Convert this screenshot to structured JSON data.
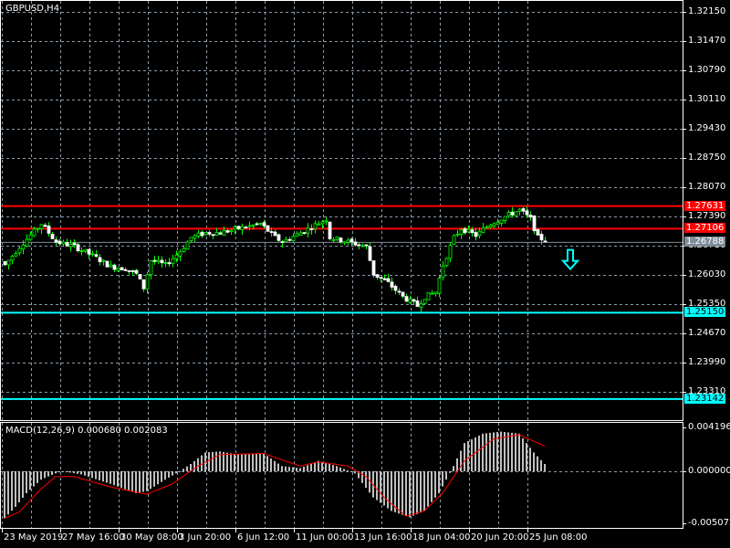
{
  "symbol_title": "GBPUSD,H4",
  "colors": {
    "background": "#000000",
    "grid": "#8a9aaa",
    "bull": "#ffffff",
    "bear": "#ffffff",
    "wick": "#00ff00",
    "resistance": "#ff0000",
    "support": "#00ffff",
    "current": "#7f8c99",
    "macd_hist": "#c0c0c0",
    "macd_signal": "#ff0000",
    "arrow": "#00ffff"
  },
  "chart_data": [
    {
      "type": "candlestick",
      "title": "GBPUSD,H4",
      "y_ticks": [
        "1.32150",
        "1.31470",
        "1.30790",
        "1.30110",
        "1.29430",
        "1.28750",
        "1.28070",
        "1.27390",
        "1.26710",
        "1.26030",
        "1.25350",
        "1.24670",
        "1.23990",
        "1.23310"
      ],
      "ylim": [
        1.2265,
        1.3245
      ],
      "x_labels": [
        "23 May 2019",
        "27 May 16:00",
        "30 May 08:00",
        "3 Jun 20:00",
        "6 Jun 12:00",
        "11 Jun 00:00",
        "13 Jun 16:00",
        "18 Jun 04:00",
        "20 Jun 20:00",
        "25 Jun 08:00"
      ],
      "bar_count": 149,
      "close_keypoints": [
        [
          0,
          1.2626
        ],
        [
          4,
          1.2669
        ],
        [
          10,
          1.2722
        ],
        [
          14,
          1.268
        ],
        [
          19,
          1.2669
        ],
        [
          24,
          1.2648
        ],
        [
          29,
          1.2622
        ],
        [
          33,
          1.2618
        ],
        [
          36,
          1.2605
        ],
        [
          38,
          1.2573
        ],
        [
          40,
          1.2637
        ],
        [
          44,
          1.2626
        ],
        [
          48,
          1.2658
        ],
        [
          51,
          1.269
        ],
        [
          55,
          1.2701
        ],
        [
          59,
          1.2701
        ],
        [
          64,
          1.2711
        ],
        [
          70,
          1.2722
        ],
        [
          74,
          1.269
        ],
        [
          76,
          1.268
        ],
        [
          81,
          1.2701
        ],
        [
          88,
          1.2733
        ],
        [
          89,
          1.269
        ],
        [
          94,
          1.268
        ],
        [
          99,
          1.2669
        ],
        [
          101,
          1.2605
        ],
        [
          105,
          1.2584
        ],
        [
          109,
          1.2552
        ],
        [
          113,
          1.2531
        ],
        [
          115,
          1.2552
        ],
        [
          118,
          1.2563
        ],
        [
          120,
          1.2626
        ],
        [
          123,
          1.269
        ],
        [
          125,
          1.2711
        ],
        [
          129,
          1.2695
        ],
        [
          133,
          1.2722
        ],
        [
          138,
          1.2743
        ],
        [
          141,
          1.2754
        ],
        [
          144,
          1.2733
        ],
        [
          146,
          1.269
        ],
        [
          148,
          1.2684
        ]
      ],
      "horizontal_lines": [
        {
          "price": 1.27631,
          "label": "1.27631",
          "kind": "resistance"
        },
        {
          "price": 1.27106,
          "label": "1.27106",
          "kind": "resistance"
        },
        {
          "price": 1.26788,
          "label": "1.26788",
          "kind": "current"
        },
        {
          "price": 1.2515,
          "label": "1.25150",
          "kind": "support"
        },
        {
          "price": 1.23142,
          "label": "1.23142",
          "kind": "support"
        }
      ],
      "signal_arrow": {
        "direction": "down",
        "price": 1.264
      }
    },
    {
      "type": "bar+line",
      "title": "MACD(12,26,9) 0.000680 0.002083",
      "y_ticks": [
        "0.004196",
        "0.000000",
        "-0.005072"
      ],
      "ylim": [
        -0.005072,
        0.004196
      ],
      "histogram_keypoints": [
        [
          0,
          -0.0045
        ],
        [
          3,
          -0.0034
        ],
        [
          6,
          -0.0021
        ],
        [
          10,
          -0.0008
        ],
        [
          14,
          -0.0002
        ],
        [
          16,
          0.0
        ],
        [
          21,
          -0.0003
        ],
        [
          29,
          -0.0012
        ],
        [
          36,
          -0.0021
        ],
        [
          39,
          -0.0019
        ],
        [
          44,
          -0.0008
        ],
        [
          48,
          0.0
        ],
        [
          51,
          0.0007
        ],
        [
          55,
          0.0018
        ],
        [
          59,
          0.0019
        ],
        [
          64,
          0.0016
        ],
        [
          71,
          0.0017
        ],
        [
          76,
          0.0005
        ],
        [
          81,
          0.0003
        ],
        [
          86,
          0.001
        ],
        [
          91,
          0.0005
        ],
        [
          96,
          -0.0002
        ],
        [
          101,
          -0.0025
        ],
        [
          106,
          -0.0038
        ],
        [
          111,
          -0.0044
        ],
        [
          115,
          -0.0038
        ],
        [
          119,
          -0.0021
        ],
        [
          123,
          0.0005
        ],
        [
          126,
          0.0027
        ],
        [
          131,
          0.0036
        ],
        [
          136,
          0.0038
        ],
        [
          141,
          0.0036
        ],
        [
          145,
          0.0018
        ],
        [
          148,
          0.0007
        ]
      ],
      "signal_keypoints": [
        [
          0,
          -0.0045
        ],
        [
          4,
          -0.0039
        ],
        [
          10,
          -0.0017
        ],
        [
          14,
          -0.0005
        ],
        [
          19,
          -0.0005
        ],
        [
          29,
          -0.0015
        ],
        [
          39,
          -0.0022
        ],
        [
          46,
          -0.0012
        ],
        [
          53,
          0.0005
        ],
        [
          59,
          0.0016
        ],
        [
          71,
          0.0017
        ],
        [
          81,
          0.0005
        ],
        [
          86,
          0.0009
        ],
        [
          94,
          0.0005
        ],
        [
          99,
          -0.0005
        ],
        [
          104,
          -0.0025
        ],
        [
          110,
          -0.0043
        ],
        [
          115,
          -0.0038
        ],
        [
          120,
          -0.0021
        ],
        [
          126,
          0.001
        ],
        [
          134,
          0.0031
        ],
        [
          141,
          0.0035
        ],
        [
          148,
          0.0024
        ]
      ]
    }
  ]
}
